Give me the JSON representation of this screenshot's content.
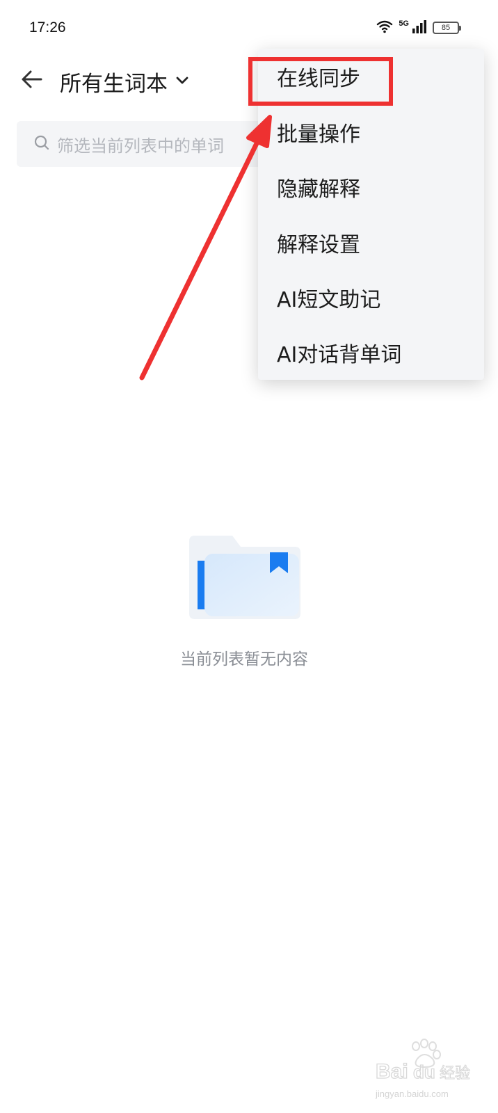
{
  "status_bar": {
    "time": "17:26",
    "network": "5G",
    "battery": "85",
    "icons": [
      "wifi-icon",
      "signal-icon",
      "battery-icon"
    ]
  },
  "header": {
    "back_icon": "arrow-left-icon",
    "title": "所有生词本",
    "title_dropdown_icon": "chevron-down-icon"
  },
  "search": {
    "icon": "search-icon",
    "placeholder": "筛选当前列表中的单词"
  },
  "menu": {
    "items": [
      {
        "label": "在线同步"
      },
      {
        "label": "批量操作"
      },
      {
        "label": "隐藏解释"
      },
      {
        "label": "解释设置"
      },
      {
        "label": "AI短文助记"
      },
      {
        "label": "AI对话背单词"
      }
    ]
  },
  "annotation": {
    "color": "#ee3131",
    "highlighted_item": "在线同步"
  },
  "empty_state": {
    "icon": "empty-folder-icon",
    "text": "当前列表暂无内容"
  },
  "watermark": {
    "logo": "Baidu经验",
    "url": "jingyan.baidu.com"
  },
  "colors": {
    "accent": "#1a7cf0",
    "menu_bg": "#f4f5f7",
    "annotation": "#ee3131"
  }
}
